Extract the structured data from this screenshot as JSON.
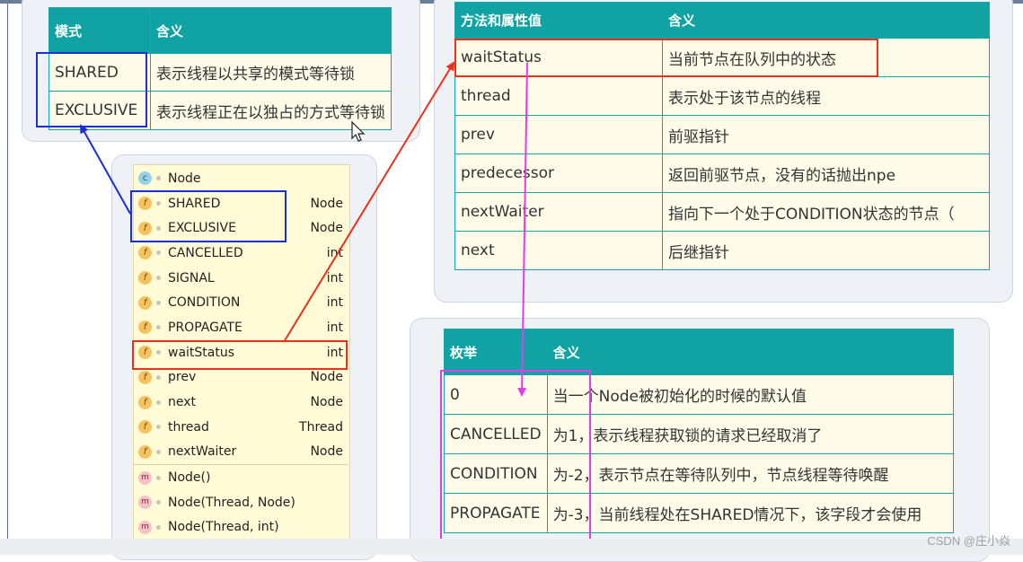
{
  "mode_table": {
    "headers": [
      "模式",
      "含义"
    ],
    "rows": [
      [
        "SHARED",
        "表示线程以共享的模式等待锁"
      ],
      [
        "EXCLUSIVE",
        "表示线程正在以独占的方式等待锁"
      ]
    ]
  },
  "attr_table": {
    "headers": [
      "方法和属性值",
      "含义"
    ],
    "rows": [
      [
        "waitStatus",
        "当前节点在队列中的状态"
      ],
      [
        "thread",
        "表示处于该节点的线程"
      ],
      [
        "prev",
        "前驱指针"
      ],
      [
        "predecessor",
        "返回前驱节点，没有的话抛出npe"
      ],
      [
        "nextWaiter",
        "指向下一个处于CONDITION状态的节点（"
      ],
      [
        "next",
        "后继指针"
      ]
    ]
  },
  "enum_table": {
    "headers": [
      "枚举",
      "含义"
    ],
    "rows": [
      [
        "0",
        "当一个Node被初始化的时候的默认值"
      ],
      [
        "CANCELLED",
        "为1，表示线程获取锁的请求已经取消了"
      ],
      [
        "CONDITION",
        "为-2，表示节点在等待队列中，节点线程等待唤醒"
      ],
      [
        "PROPAGATE",
        "为-3，当前线程处在SHARED情况下，该字段才会使用"
      ]
    ]
  },
  "class_panel": {
    "title": "Node",
    "title_icon": "class-icon",
    "fields": [
      {
        "name": "SHARED",
        "type": "Node",
        "icon": "static-field-icon"
      },
      {
        "name": "EXCLUSIVE",
        "type": "Node",
        "icon": "static-field-icon"
      },
      {
        "name": "CANCELLED",
        "type": "int",
        "icon": "static-field-icon"
      },
      {
        "name": "SIGNAL",
        "type": "int",
        "icon": "static-field-icon"
      },
      {
        "name": "CONDITION",
        "type": "int",
        "icon": "static-field-icon"
      },
      {
        "name": "PROPAGATE",
        "type": "int",
        "icon": "static-field-icon"
      },
      {
        "name": "waitStatus",
        "type": "int",
        "icon": "field-icon"
      },
      {
        "name": "prev",
        "type": "Node",
        "icon": "field-icon"
      },
      {
        "name": "next",
        "type": "Node",
        "icon": "field-icon"
      },
      {
        "name": "thread",
        "type": "Thread",
        "icon": "field-icon"
      },
      {
        "name": "nextWaiter",
        "type": "Node",
        "icon": "field-icon"
      }
    ],
    "methods": [
      {
        "name": "Node()",
        "icon": "method-icon"
      },
      {
        "name": "Node(Thread, Node)",
        "icon": "method-icon"
      },
      {
        "name": "Node(Thread, int)",
        "icon": "method-icon"
      }
    ]
  },
  "icon_glyphs": {
    "class": "c",
    "field": "f",
    "method": "m"
  },
  "colors": {
    "teal_header": "#11a3a4",
    "cell_bg": "#fefce8",
    "blue_highlight": "#1a2fd6",
    "red_highlight": "#e8321c",
    "magenta_highlight": "#e23ee8"
  },
  "watermark": "CSDN @庄小焱"
}
